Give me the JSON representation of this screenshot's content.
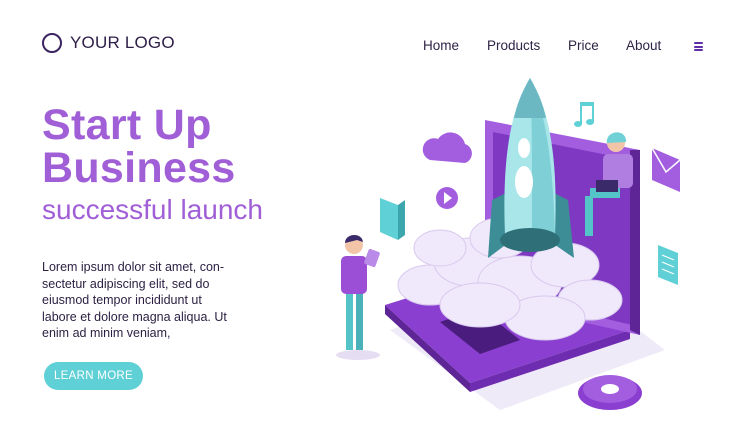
{
  "logo": {
    "text": "YOUR LOGO"
  },
  "nav": {
    "items": [
      "Home",
      "Products",
      "Price",
      "About"
    ]
  },
  "hero": {
    "title_line1": "Start Up",
    "title_line2": "Business",
    "subtitle": "successful launch",
    "body_lines": [
      "Lorem ipsum dolor sit amet, con-",
      "sectetur adipiscing elit, sed do",
      "eiusmod tempor incididunt ut",
      "labore et dolore magna aliqua. Ut",
      "enim ad minim veniam,"
    ],
    "cta_label": "LEARN MORE"
  },
  "colors": {
    "accent_purple": "#a05fd6",
    "laptop_purple": "#8b3fd0",
    "teal": "#5fd0d6",
    "dark_text": "#2d1f4a"
  },
  "illustration": {
    "icons": [
      "rocket-icon",
      "cloud-icon",
      "music-note-icon",
      "play-icon",
      "book-icon",
      "email-icon",
      "document-icon",
      "gear-icon",
      "laptop-icon"
    ]
  }
}
